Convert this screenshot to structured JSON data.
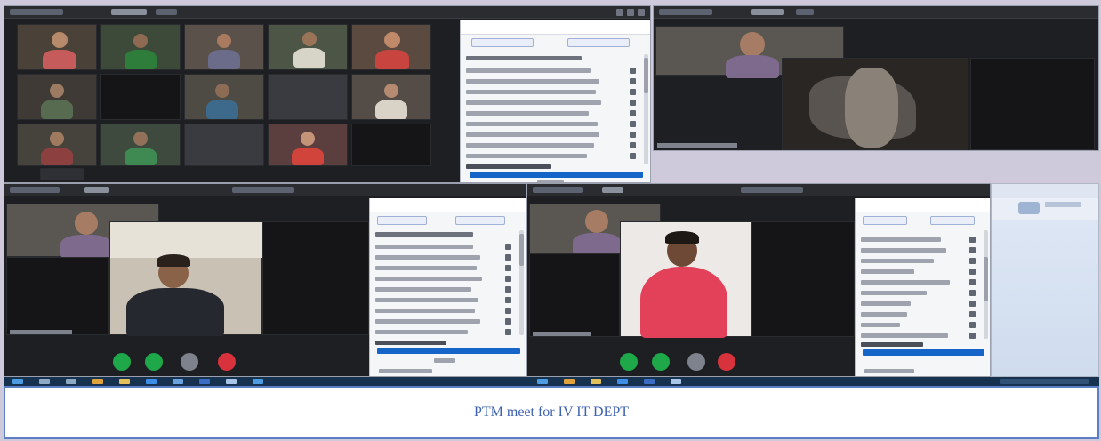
{
  "caption": "PTM meet for IV IT DEPT",
  "screens": [
    {
      "name": "gallery-view",
      "layout": "participant grid with participants panel"
    },
    {
      "name": "speaker-view-top-right",
      "layout": "speaker view"
    },
    {
      "name": "speaker-view-bottom-left",
      "layout": "speaker view with participants panel"
    },
    {
      "name": "speaker-view-bottom-right",
      "layout": "speaker view with participants panel"
    }
  ],
  "colors": {
    "caption_text": "#3d62b0",
    "caption_border": "#5b7ec4",
    "meeting_bg": "#1e1f22",
    "panel_bg": "#f5f6f8",
    "accent_blue": "#1565c8",
    "control_green": "#1ea84a",
    "control_red": "#d8323c",
    "taskbar": "#17324f"
  }
}
